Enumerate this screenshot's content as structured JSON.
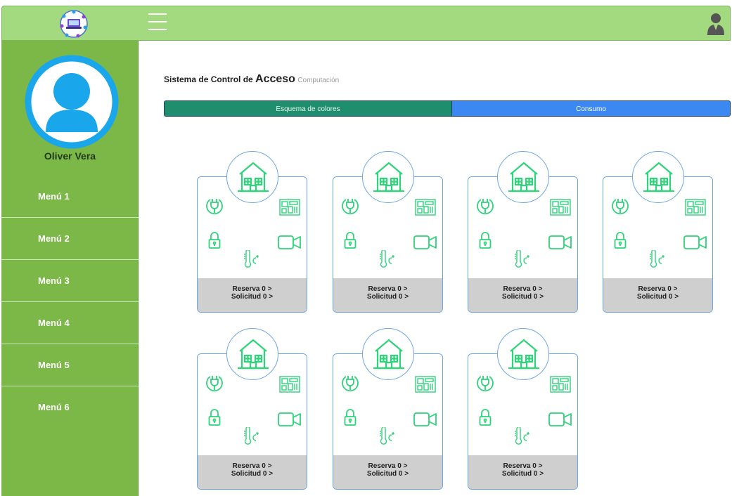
{
  "header": {
    "logo_icon": "network-laptop-logo",
    "menu_icon": "hamburger-icon",
    "user_icon": "user-icon"
  },
  "sidebar": {
    "user_name": "Oliver Vera",
    "items": [
      {
        "label": "Menú 1"
      },
      {
        "label": "Menú 2"
      },
      {
        "label": "Menú 3"
      },
      {
        "label": "Menú 4"
      },
      {
        "label": "Menú 5"
      },
      {
        "label": "Menú 6"
      }
    ]
  },
  "main": {
    "title_prefix": "Sistema de Control de ",
    "title_emphasis": "Acceso",
    "title_sub": "Computación",
    "tabs": [
      {
        "label": "Esquema de colores",
        "color": "#1f8e6c"
      },
      {
        "label": "Consumo",
        "color": "#3b88f2"
      }
    ],
    "cards": [
      {
        "reserva": "Reserva 0 >",
        "solicitud": "Solicitud 0 >"
      },
      {
        "reserva": "Reserva 0 >",
        "solicitud": "Solicitud 0 >"
      },
      {
        "reserva": "Reserva 0 >",
        "solicitud": "Solicitud 0 >"
      },
      {
        "reserva": "Reserva 0 >",
        "solicitud": "Solicitud 0 >"
      },
      {
        "reserva": "Reserva 0 >",
        "solicitud": "Solicitud 0 >"
      },
      {
        "reserva": "Reserva 0 >",
        "solicitud": "Solicitud 0 >"
      },
      {
        "reserva": "Reserva 0 >",
        "solicitud": "Solicitud 0 >"
      }
    ]
  },
  "colors": {
    "topbar": "#a3d97f",
    "sidebar": "#7cb848",
    "icon_green": "#2ed37a",
    "card_border": "#6aa6e0",
    "footer_gray": "#cfcfcf"
  }
}
